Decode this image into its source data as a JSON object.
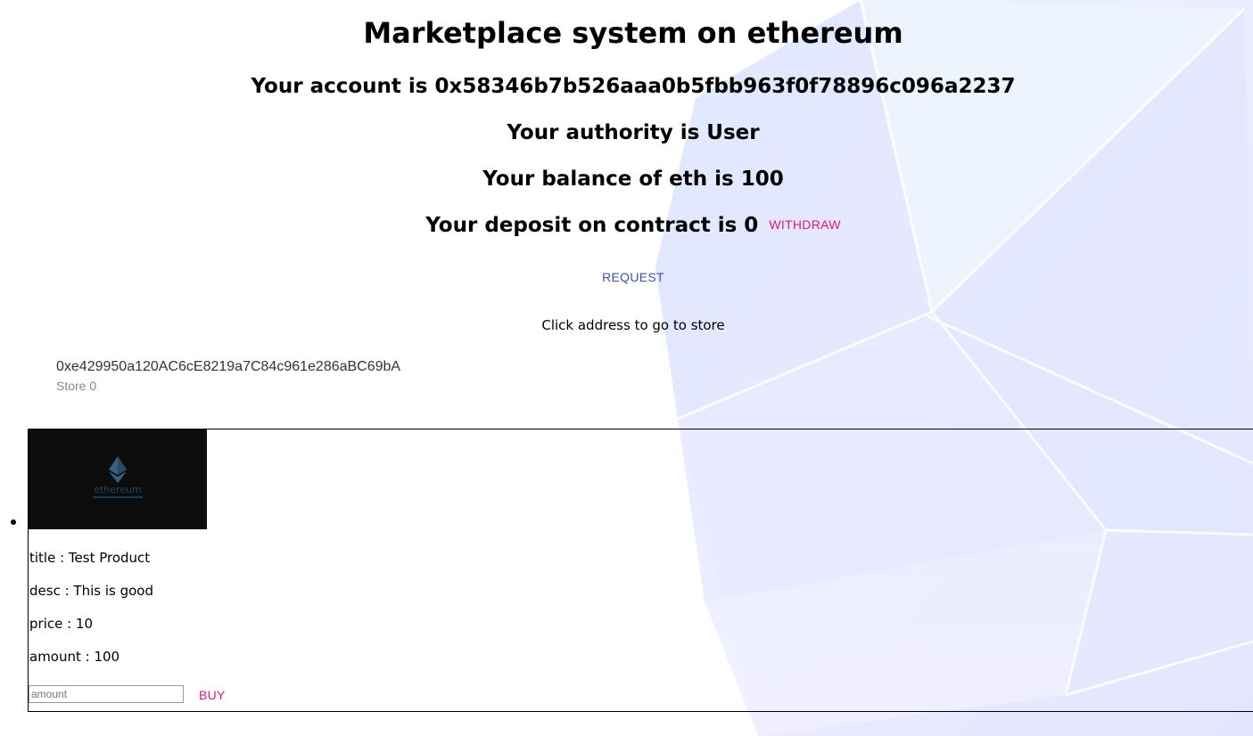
{
  "header": {
    "title": "Marketplace system on ethereum",
    "account_line": "Your account is 0x58346b7b526aaa0b5fbb963f0f78896c096a2237",
    "authority_line": "Your authority is User",
    "balance_line": "Your balance of eth is 100",
    "deposit_line": "Your deposit on contract is 0",
    "withdraw_label": "WITHDRAW"
  },
  "request_label": "REQUEST",
  "store_hint": "Click address to go to store",
  "stores": [
    {
      "address": "0xe429950a120AC6cE8219a7C84c961e286aBC69bA",
      "name": "Store 0"
    }
  ],
  "product": {
    "image_icon": "ethereum-logo-icon",
    "image_logo_text": "ethereum",
    "title_line": "title : Test Product",
    "desc_line": "desc : This is good",
    "price_line": "price : 10",
    "amount_line": "amount : 100",
    "amount_placeholder": "amount",
    "buy_label": "BUY"
  },
  "colors": {
    "accent_pink": "#e0187e",
    "accent_indigo": "#3f51b5",
    "background_crystal": "#e6e8ff"
  }
}
